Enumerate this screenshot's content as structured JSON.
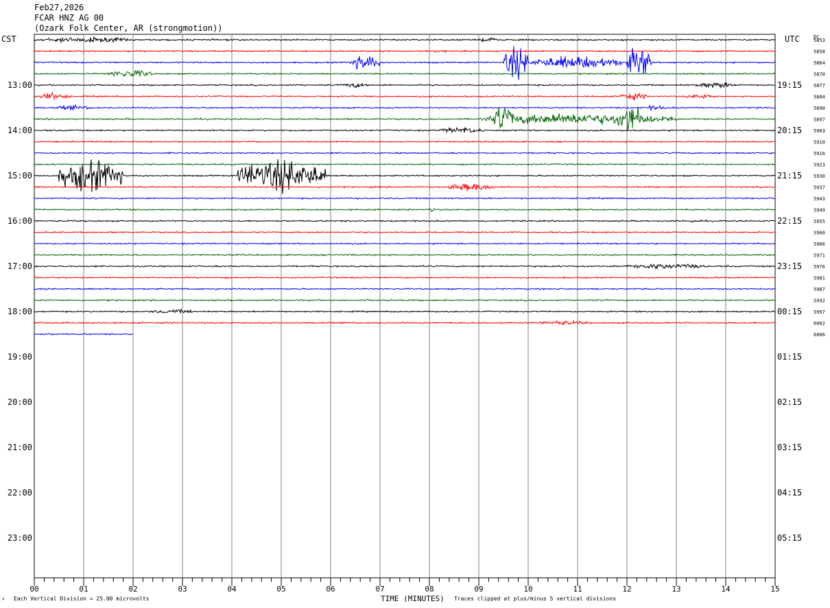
{
  "header": {
    "date": "Feb27,2026",
    "channel": "FCAR HNZ AG 00",
    "station": "(Ozark Folk Center, AR (strongmotion))"
  },
  "tz_left": "CST",
  "tz_right": "UTC",
  "dc_label": "DC",
  "footer": {
    "division": "Each Vertical Division =   25.00 microvolts",
    "clip": "Traces clipped at plus/minus 5 vertical divisions",
    "corner": "↗"
  },
  "chart_data": {
    "type": "line",
    "title": "FCAR HNZ AG 00",
    "xlabel": "TIME (MINUTES)",
    "x_ticks": [
      "00",
      "01",
      "02",
      "03",
      "04",
      "05",
      "06",
      "07",
      "08",
      "09",
      "10",
      "11",
      "12",
      "13",
      "14",
      "15"
    ],
    "xlim": [
      0,
      15
    ],
    "trace_minutes": 15,
    "left_time_labels": [
      "13:00",
      "14:00",
      "15:00",
      "16:00",
      "17:00",
      "18:00",
      "19:00",
      "20:00",
      "21:00",
      "22:00",
      "23:00"
    ],
    "right_time_labels": [
      "19:15",
      "20:15",
      "21:15",
      "22:15",
      "23:15",
      "00:15",
      "01:15",
      "02:15",
      "03:15",
      "04:15",
      "05:15"
    ],
    "series_colors": [
      "#000000",
      "#ff0000",
      "#0000ff",
      "#006400"
    ],
    "dc_offsets": [
      5853,
      5858,
      5864,
      5870,
      5877,
      5884,
      5890,
      5897,
      5903,
      5910,
      5916,
      5923,
      5930,
      5937,
      5943,
      5949,
      5955,
      5960,
      5966,
      5971,
      5976,
      5981,
      5987,
      5992,
      5997,
      6002,
      6006
    ],
    "last_trace_end_minute": 2.0,
    "events": [
      {
        "trace": 0,
        "start": 0.0,
        "end": 2.0,
        "amp": 0.7
      },
      {
        "trace": 0,
        "start": 9.0,
        "end": 9.4,
        "amp": 0.6
      },
      {
        "trace": 1,
        "start": 7.9,
        "end": 8.4,
        "amp": 0.4
      },
      {
        "trace": 2,
        "start": 6.4,
        "end": 7.0,
        "amp": 1.8
      },
      {
        "trace": 2,
        "start": 9.5,
        "end": 10.0,
        "amp": 4.0
      },
      {
        "trace": 2,
        "start": 10.0,
        "end": 11.9,
        "amp": 1.6
      },
      {
        "trace": 2,
        "start": 12.0,
        "end": 12.5,
        "amp": 4.0
      },
      {
        "trace": 3,
        "start": 1.5,
        "end": 2.4,
        "amp": 1.0
      },
      {
        "trace": 4,
        "start": 6.2,
        "end": 6.8,
        "amp": 0.6
      },
      {
        "trace": 4,
        "start": 13.4,
        "end": 14.2,
        "amp": 0.8
      },
      {
        "trace": 5,
        "start": 0.1,
        "end": 0.7,
        "amp": 0.9
      },
      {
        "trace": 5,
        "start": 11.8,
        "end": 12.4,
        "amp": 0.9
      },
      {
        "trace": 5,
        "start": 13.2,
        "end": 13.8,
        "amp": 0.6
      },
      {
        "trace": 6,
        "start": 0.4,
        "end": 1.2,
        "amp": 0.6
      },
      {
        "trace": 6,
        "start": 12.3,
        "end": 12.8,
        "amp": 0.6
      },
      {
        "trace": 7,
        "start": 9.0,
        "end": 13.0,
        "amp": 1.4
      },
      {
        "trace": 7,
        "start": 9.3,
        "end": 9.7,
        "amp": 4.0
      },
      {
        "trace": 7,
        "start": 11.8,
        "end": 12.3,
        "amp": 4.0
      },
      {
        "trace": 8,
        "start": 8.2,
        "end": 9.1,
        "amp": 0.8
      },
      {
        "trace": 12,
        "start": 0.5,
        "end": 1.8,
        "amp": 4.0
      },
      {
        "trace": 12,
        "start": 4.1,
        "end": 5.9,
        "amp": 4.0
      },
      {
        "trace": 13,
        "start": 8.4,
        "end": 9.3,
        "amp": 1.0
      },
      {
        "trace": 15,
        "start": 8.0,
        "end": 8.1,
        "amp": 0.8
      },
      {
        "trace": 16,
        "start": 13.2,
        "end": 13.5,
        "amp": 0.4
      },
      {
        "trace": 20,
        "start": 12.0,
        "end": 13.6,
        "amp": 0.7
      },
      {
        "trace": 24,
        "start": 2.3,
        "end": 3.3,
        "amp": 0.5
      },
      {
        "trace": 25,
        "start": 10.2,
        "end": 11.2,
        "amp": 0.6
      }
    ]
  }
}
